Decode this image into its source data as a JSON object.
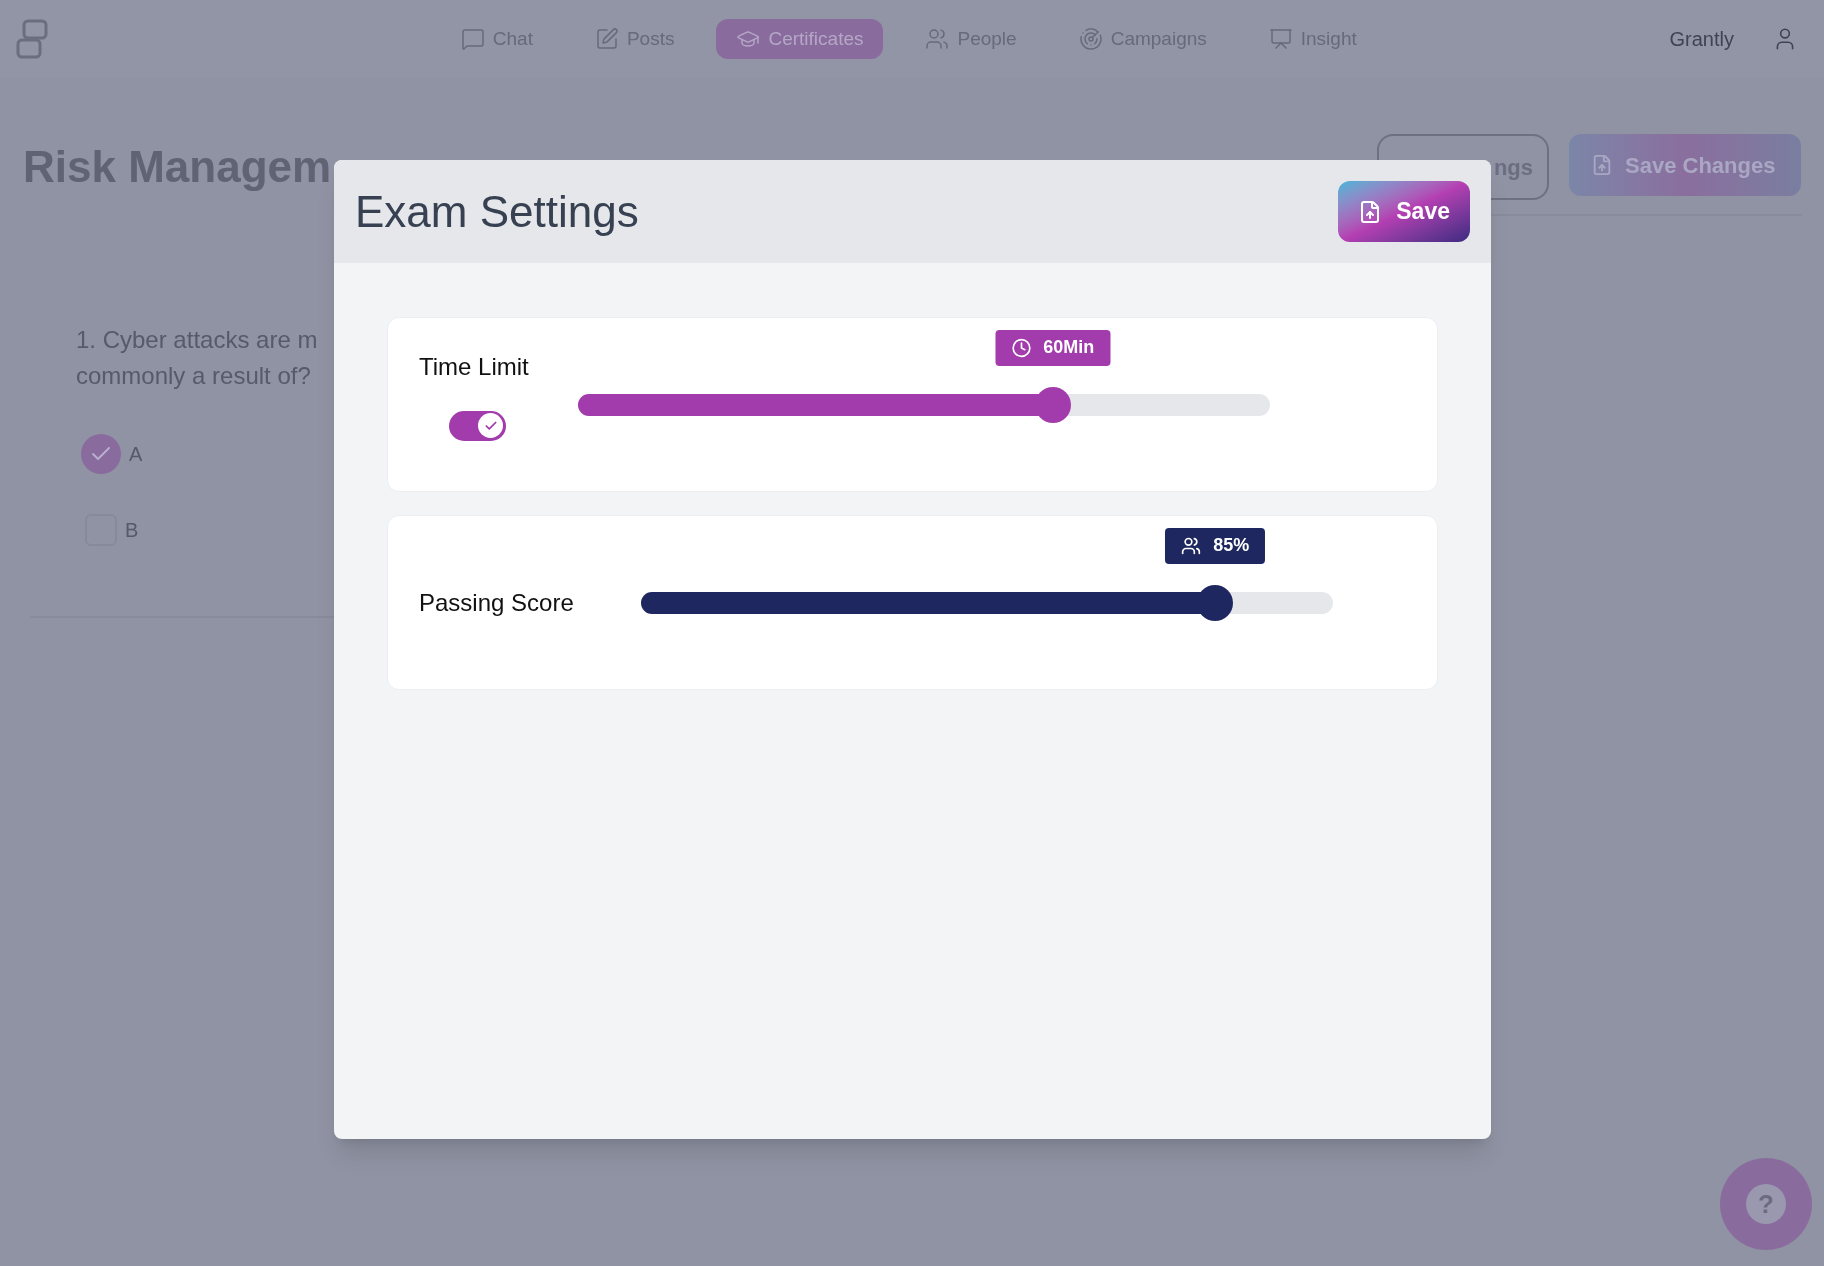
{
  "nav": {
    "items": [
      {
        "label": "Chat",
        "selected": false
      },
      {
        "label": "Posts",
        "selected": false
      },
      {
        "label": "Certificates",
        "selected": true
      },
      {
        "label": "People",
        "selected": false
      },
      {
        "label": "Campaigns",
        "selected": false
      },
      {
        "label": "Insight",
        "selected": false
      }
    ],
    "account": "Grantly"
  },
  "help_button": "?",
  "page": {
    "title": "Risk Managem",
    "settings_button": "ngs",
    "save_button": "Save Changes",
    "question": {
      "lines": [
        "1. Cyber attacks are m",
        "commonly a result of?"
      ],
      "options": [
        {
          "label": "A",
          "checked": true
        },
        {
          "label": "B",
          "checked": false
        }
      ]
    }
  },
  "dialog": {
    "title": "Exam Settings",
    "save_button": "Save",
    "settings": [
      {
        "kind": "toggle_slider",
        "label": "Time Limit",
        "on": true,
        "level": 0.686,
        "reading": "60Min",
        "color": "#a23bab"
      },
      {
        "kind": "slider",
        "label": "Passing Score",
        "level": 0.83,
        "reading": "85%",
        "color": "#1f2760"
      }
    ]
  }
}
